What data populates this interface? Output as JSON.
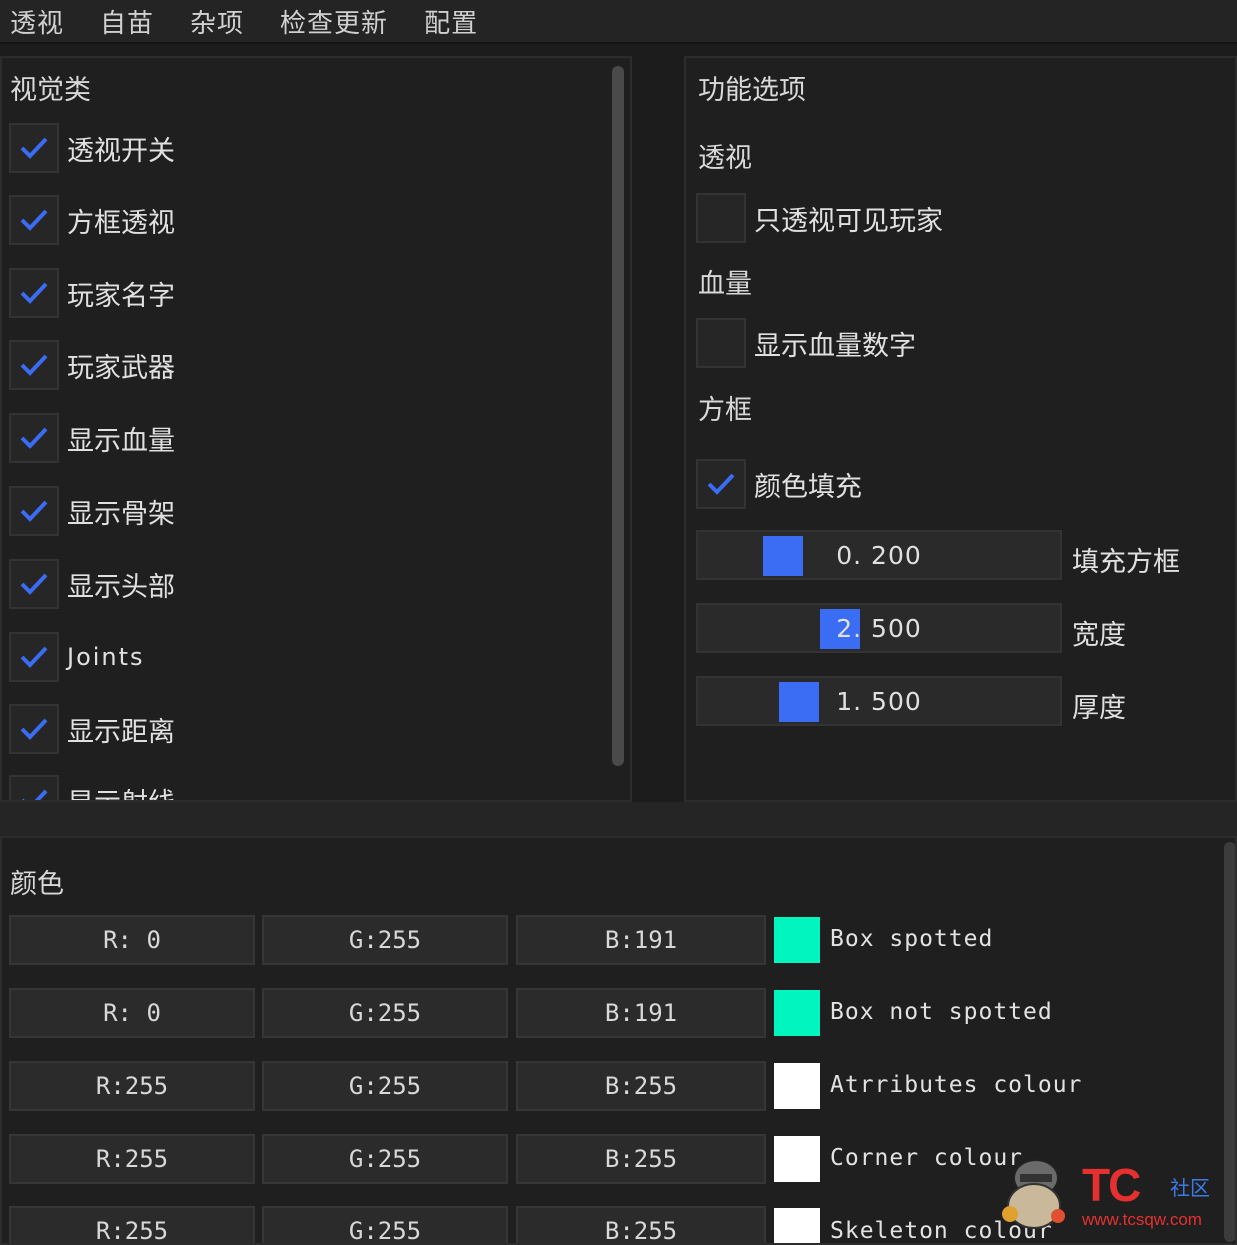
{
  "menu": [
    "透视",
    "自苗",
    "杂项",
    "检查更新",
    "配置"
  ],
  "visual": {
    "title": "视觉类",
    "items": [
      {
        "label": "透视开关",
        "checked": true
      },
      {
        "label": "方框透视",
        "checked": true
      },
      {
        "label": "玩家名字",
        "checked": true
      },
      {
        "label": "玩家武器",
        "checked": true
      },
      {
        "label": "显示血量",
        "checked": true
      },
      {
        "label": "显示骨架",
        "checked": true
      },
      {
        "label": "显示头部",
        "checked": true
      },
      {
        "label": "Joints",
        "checked": true
      },
      {
        "label": "显示距离",
        "checked": true
      },
      {
        "label": "显示射线",
        "checked": true
      }
    ]
  },
  "options": {
    "title": "功能选项",
    "esp_heading": "透视",
    "visible_only": {
      "label": "只透视可见玩家",
      "checked": false
    },
    "health_heading": "血量",
    "health_number": {
      "label": "显示血量数字",
      "checked": false
    },
    "box_heading": "方框",
    "color_fill": {
      "label": "颜色填充",
      "checked": true
    },
    "sliders": [
      {
        "value": "0. 200",
        "label": "填充方框",
        "fraction": 0.2
      },
      {
        "value": "2. 500",
        "label": "宽度",
        "fraction": 0.35
      },
      {
        "value": "1. 500",
        "label": "厚度",
        "fraction": 0.25
      }
    ]
  },
  "colors": {
    "title": "颜色",
    "rows": [
      {
        "r": "R:  0",
        "g": "G:255",
        "b": "B:191",
        "swatch": "#00f5bf",
        "label": "Box spotted"
      },
      {
        "r": "R:  0",
        "g": "G:255",
        "b": "B:191",
        "swatch": "#00f5bf",
        "label": "Box not spotted"
      },
      {
        "r": "R:255",
        "g": "G:255",
        "b": "B:255",
        "swatch": "#ffffff",
        "label": "Atrributes colour"
      },
      {
        "r": "R:255",
        "g": "G:255",
        "b": "B:255",
        "swatch": "#ffffff",
        "label": "Corner colour"
      },
      {
        "r": "R:255",
        "g": "G:255",
        "b": "B:255",
        "swatch": "#ffffff",
        "label": "Skeleton colour"
      }
    ]
  },
  "watermark": {
    "brand": "TC",
    "cn": "社区",
    "url": "www.tcsqw.com"
  },
  "accent": "#3a6cf4"
}
